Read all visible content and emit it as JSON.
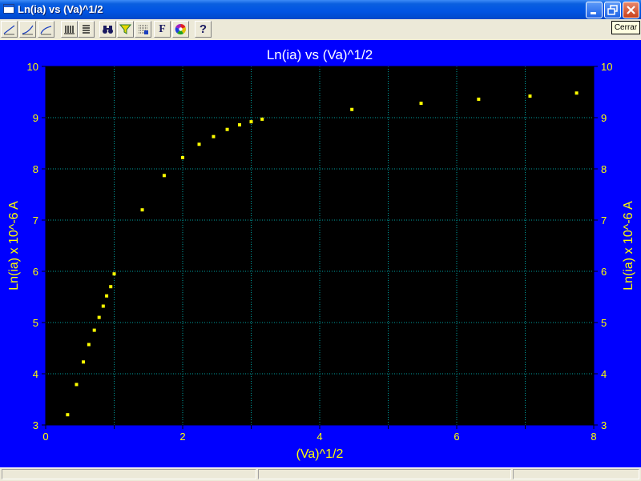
{
  "window": {
    "title": "Ln(ia) vs (Va)^1/2",
    "controls": [
      "minimize",
      "restore",
      "close"
    ]
  },
  "toolbar": {
    "buttons": [
      {
        "icon": "line-plot-icon"
      },
      {
        "icon": "curve-plot-icon"
      },
      {
        "icon": "smooth-curve-icon"
      },
      {
        "icon": "vertical-bars-icon"
      },
      {
        "icon": "horizontal-lines-icon"
      },
      {
        "icon": "binoculars-icon"
      },
      {
        "icon": "funnel-icon"
      },
      {
        "icon": "data-table-icon"
      },
      {
        "icon": "font-icon",
        "glyph": "F"
      },
      {
        "icon": "color-wheel-icon"
      },
      {
        "icon": "help-icon",
        "glyph": "?"
      }
    ]
  },
  "tooltip": "Cerrar",
  "colors": {
    "panel": "#0000ff",
    "plot": "#000000",
    "grid": "#00a0a0",
    "text": "#ffff00",
    "title": "#ffffff",
    "marker": "#ffff00"
  },
  "chart_data": {
    "type": "scatter",
    "title": "Ln(ia) vs (Va)^1/2",
    "xlabel": "(Va)^1/2",
    "ylabel": "Ln(ia) x 10^-6 A",
    "y2label": "Ln(ia) x 10^-6 A",
    "xlim": [
      0,
      8
    ],
    "ylim": [
      3,
      10
    ],
    "xticks": [
      0,
      2,
      4,
      6,
      8
    ],
    "yticks": [
      3,
      4,
      5,
      6,
      7,
      8,
      9,
      10
    ],
    "xtick_labels": [
      "0",
      "2",
      "4",
      "6",
      "8"
    ],
    "ytick_labels": [
      "3",
      "4",
      "5",
      "6",
      "7",
      "8",
      "9",
      "10"
    ],
    "xgrid_step": 1,
    "grid": true,
    "right_axis": true,
    "series": [
      {
        "points": [
          [
            0.32,
            3.2
          ],
          [
            0.45,
            3.79
          ],
          [
            0.55,
            4.23
          ],
          [
            0.63,
            4.57
          ],
          [
            0.71,
            4.85
          ],
          [
            0.78,
            5.1
          ],
          [
            0.84,
            5.32
          ],
          [
            0.89,
            5.52
          ],
          [
            0.95,
            5.7
          ],
          [
            1.0,
            5.95
          ],
          [
            1.41,
            7.2
          ],
          [
            1.73,
            7.87
          ],
          [
            2.0,
            8.22
          ],
          [
            2.24,
            8.48
          ],
          [
            2.45,
            8.63
          ],
          [
            2.65,
            8.77
          ],
          [
            2.83,
            8.86
          ],
          [
            3.0,
            8.92
          ],
          [
            3.16,
            8.97
          ],
          [
            4.47,
            9.16
          ],
          [
            5.48,
            9.28
          ],
          [
            6.32,
            9.36
          ],
          [
            7.07,
            9.42
          ],
          [
            7.75,
            9.48
          ]
        ]
      }
    ]
  }
}
